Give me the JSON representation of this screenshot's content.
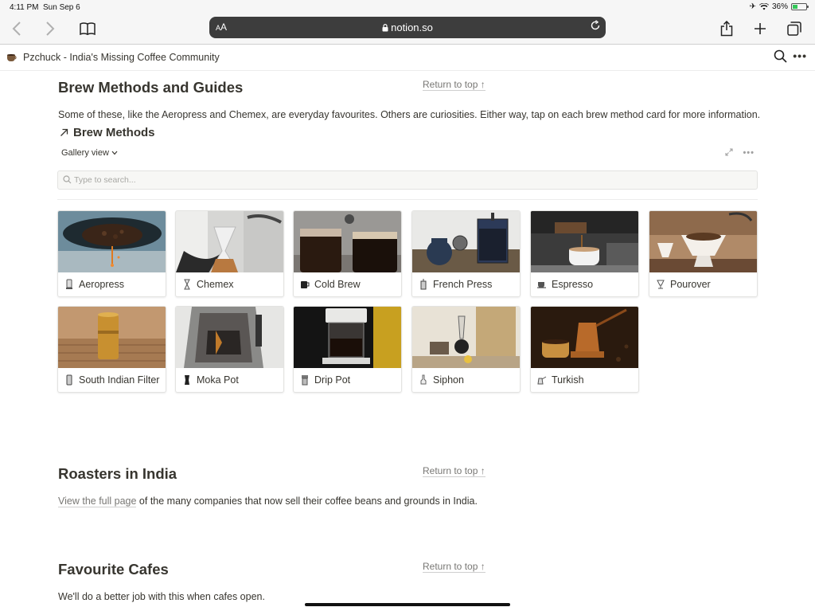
{
  "status": {
    "time": "4:11 PM",
    "date": "Sun Sep 6",
    "battery": "36%"
  },
  "browser": {
    "aa_label": "AA",
    "host": "notion.so"
  },
  "topbar": {
    "breadcrumb": "Pzchuck - India's Missing Coffee Community",
    "page_icon": "coffee-cup-icon"
  },
  "sections": {
    "brew": {
      "title": "Brew Methods and Guides",
      "return": "Return to top ↑",
      "intro": "Some of these, like the Aeropress and Chemex, are everyday favourites. Others are curiosities. Either way, tap on each brew method card for more information.",
      "db_title": "Brew Methods",
      "view": "Gallery view",
      "search_placeholder": "Type to search..."
    },
    "roasters": {
      "title": "Roasters in India",
      "return": "Return to top ↑",
      "link": "View the full page",
      "text": " of the many companies that now sell their coffee beans and grounds in India."
    },
    "cafes": {
      "title": "Favourite Cafes",
      "return": "Return to top ↑",
      "text": "We'll do a better job with this when cafes open."
    }
  },
  "gallery": [
    {
      "label": "Aeropress",
      "icon": "aeropress-icon"
    },
    {
      "label": "Chemex",
      "icon": "chemex-icon"
    },
    {
      "label": "Cold Brew",
      "icon": "jar-icon"
    },
    {
      "label": "French Press",
      "icon": "french-press-icon"
    },
    {
      "label": "Espresso",
      "icon": "espresso-cup-icon"
    },
    {
      "label": "Pourover",
      "icon": "dripper-icon"
    },
    {
      "label": "South Indian Filter",
      "icon": "filter-icon"
    },
    {
      "label": "Moka Pot",
      "icon": "moka-pot-icon"
    },
    {
      "label": "Drip Pot",
      "icon": "drip-pot-icon"
    },
    {
      "label": "Siphon",
      "icon": "siphon-icon"
    },
    {
      "label": "Turkish",
      "icon": "cezve-icon"
    }
  ]
}
